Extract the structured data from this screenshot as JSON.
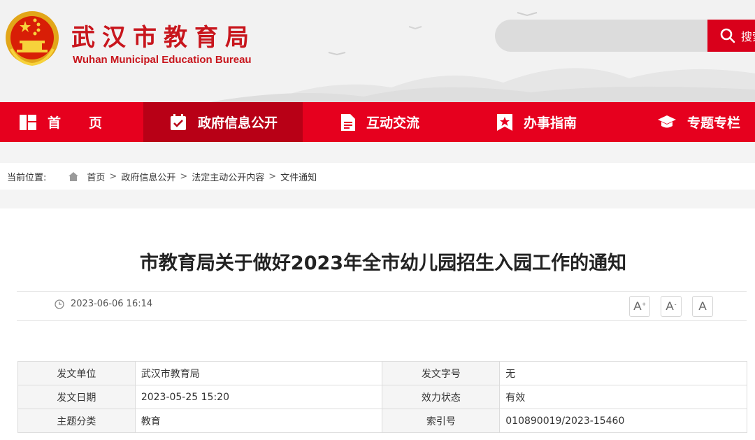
{
  "header": {
    "title": "武汉市教育局",
    "subtitle": "Wuhan Municipal Education Bureau",
    "emblem_icon": "national-emblem-icon",
    "search": {
      "placeholder": "",
      "button_label": "搜索",
      "icon": "search-icon"
    }
  },
  "nav": {
    "items": [
      {
        "label": "首页",
        "icon": "home-grid-icon"
      },
      {
        "label": "政府信息公开",
        "icon": "calendar-check-icon",
        "active": true
      },
      {
        "label": "互动交流",
        "icon": "document-icon"
      },
      {
        "label": "办事指南",
        "icon": "bookmark-star-icon"
      },
      {
        "label": "专题专栏",
        "icon": "graduation-cap-icon"
      }
    ]
  },
  "breadcrumb": {
    "label": "当前位置:",
    "items": [
      "首页",
      "政府信息公开",
      "法定主动公开内容",
      "文件通知"
    ],
    "separator": ">"
  },
  "article": {
    "title": "市教育局关于做好2023年全市幼儿园招生入园工作的通知",
    "publish_time": "2023-06-06 16:14",
    "font_controls": [
      {
        "label": "A",
        "mark": "+"
      },
      {
        "label": "A",
        "mark": "-"
      },
      {
        "label": "A",
        "mark": ""
      }
    ]
  },
  "info_table": {
    "rows": [
      [
        "发文单位",
        "武汉市教育局",
        "发文字号",
        "无"
      ],
      [
        "发文日期",
        "2023-05-25 15:20",
        "效力状态",
        "有效"
      ],
      [
        "主题分类",
        "教育",
        "索引号",
        "010890019/2023-15460"
      ]
    ]
  },
  "colors": {
    "brand_red": "#e6001e",
    "nav_active": "#b80016",
    "title_red": "#c8161d"
  }
}
